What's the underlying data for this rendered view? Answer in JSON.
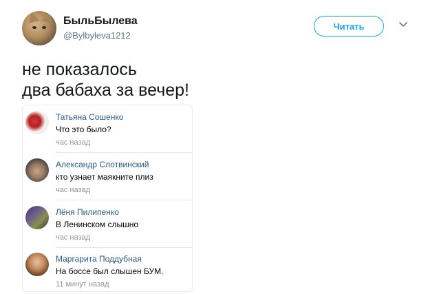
{
  "tweet": {
    "display_name": "БыльБылева",
    "handle": "@Bylbyleva1212",
    "follow_label": "Читать",
    "text": "не показалось\nдва бабаха за вечер!",
    "avatar_icon": "cat-avatar-icon",
    "menu_icon": "chevron-down-icon"
  },
  "comments": [
    {
      "author": "Татьяна Сошенко",
      "text": "Что это было?",
      "time": "час назад",
      "avatar": "avatar-flower"
    },
    {
      "author": "Александр Слотвинский",
      "text": "кто узнает маякните плиз",
      "time": "час назад",
      "avatar": "avatar-man"
    },
    {
      "author": "Лёня Пилипенко",
      "text": "В Ленинском слышно",
      "time": "час назад",
      "avatar": "avatar-purple"
    },
    {
      "author": "Маргарита Поддубная",
      "text": "На боссе был слышен БУМ.",
      "time": "11 минут назад",
      "avatar": "avatar-woman"
    }
  ],
  "colors": {
    "twitter_blue": "#1da1f2",
    "vk_link": "#2a5885",
    "muted": "#939393"
  }
}
